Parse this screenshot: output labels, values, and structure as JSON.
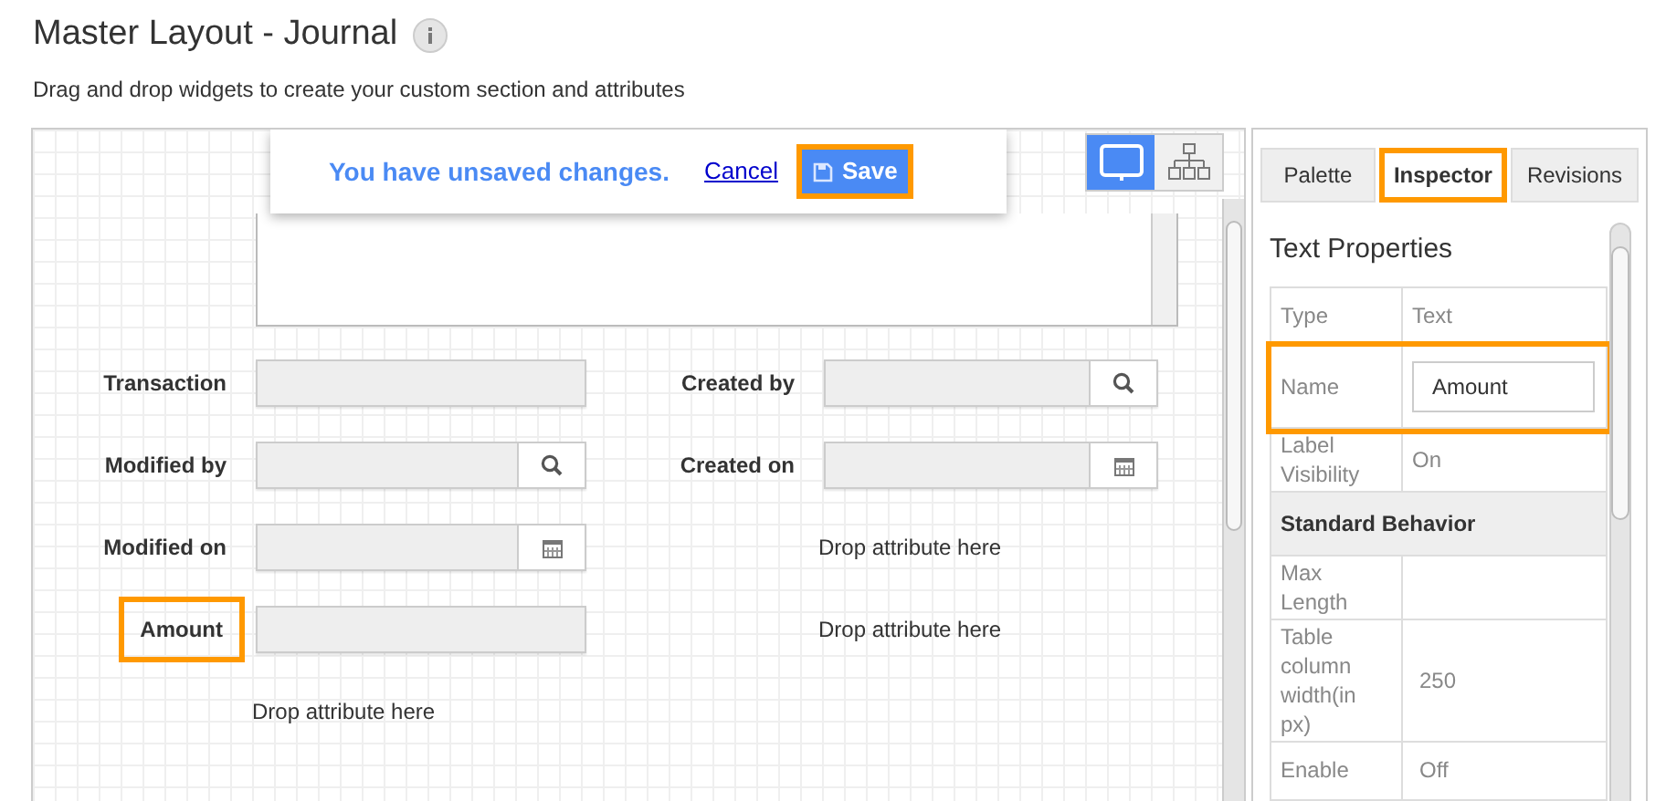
{
  "page": {
    "title": "Master Layout - Journal",
    "subtitle": "Drag and drop widgets to create your custom section and attributes"
  },
  "banner": {
    "message": "You have unsaved changes.",
    "cancel": "Cancel",
    "save": {
      "label": "Save",
      "highlighted": true
    }
  },
  "view_toggle": [
    {
      "kind": "desktop",
      "selected": true
    },
    {
      "kind": "hierarchy",
      "selected": false
    }
  ],
  "left_column": [
    {
      "kind": "text",
      "label": "Transaction",
      "highlighted": false
    },
    {
      "kind": "lookup",
      "label": "Modified by",
      "highlighted": false
    },
    {
      "kind": "date",
      "label": "Modified on",
      "highlighted": false
    },
    {
      "kind": "text",
      "label": "Amount",
      "highlighted": true
    },
    {
      "kind": "drop",
      "text": "Drop attribute here"
    }
  ],
  "right_column": [
    {
      "kind": "lookup",
      "label": "Created by",
      "highlighted": false
    },
    {
      "kind": "date",
      "label": "Created on",
      "highlighted": false
    },
    {
      "kind": "drop",
      "text": "Drop attribute here"
    },
    {
      "kind": "drop",
      "text": "Drop attribute here"
    }
  ],
  "tabs": [
    {
      "label": "Palette",
      "selected": false,
      "highlighted": false
    },
    {
      "label": "Inspector",
      "selected": true,
      "highlighted": true
    },
    {
      "label": "Revisions",
      "selected": false,
      "highlighted": false
    }
  ],
  "inspector": {
    "title": "Text Properties",
    "rows": [
      {
        "kind": "property",
        "name": "Type",
        "value": "Text",
        "highlighted": false
      },
      {
        "kind": "input",
        "name": "Name",
        "value": "Amount",
        "highlighted": true
      },
      {
        "kind": "property",
        "name": "Label Visibility",
        "value": "On",
        "highlighted": false
      },
      {
        "kind": "section",
        "name": "Standard Behavior"
      },
      {
        "kind": "property",
        "name": "Max Length",
        "value": "",
        "highlighted": false
      },
      {
        "kind": "property",
        "name": "Table column width(in px)",
        "value": "250",
        "highlighted": false
      },
      {
        "kind": "property",
        "name": "Enable",
        "value": "Off",
        "highlighted": false
      }
    ]
  }
}
